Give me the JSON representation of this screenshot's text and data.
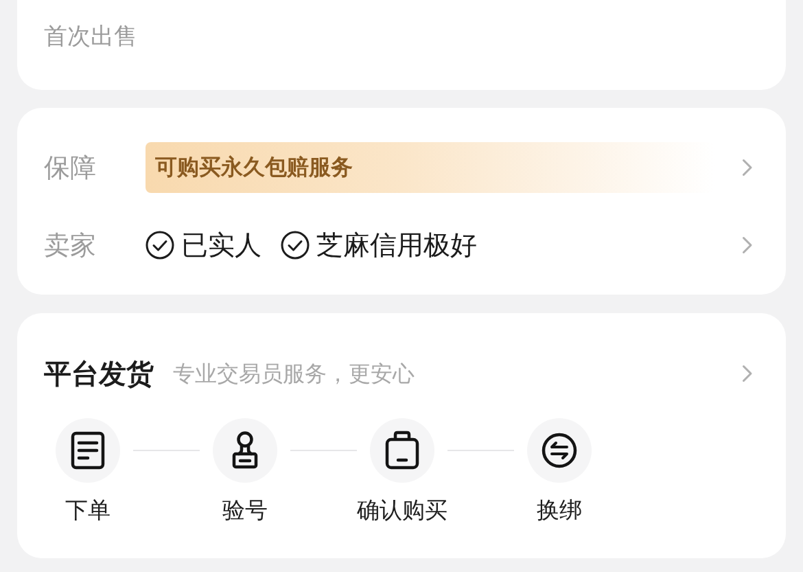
{
  "listing_card": {
    "note": "首次出售"
  },
  "assurance_card": {
    "rows": [
      {
        "kind": "banner",
        "label": "保障",
        "text": "可购买永久包赔服务"
      },
      {
        "kind": "credentials",
        "label": "卖家",
        "items": [
          "已实人",
          "芝麻信用极好"
        ]
      }
    ]
  },
  "delivery_card": {
    "title": "平台发货",
    "subtitle": "专业交易员服务，更安心",
    "steps": [
      "下单",
      "验号",
      "确认购买",
      "换绑"
    ]
  }
}
